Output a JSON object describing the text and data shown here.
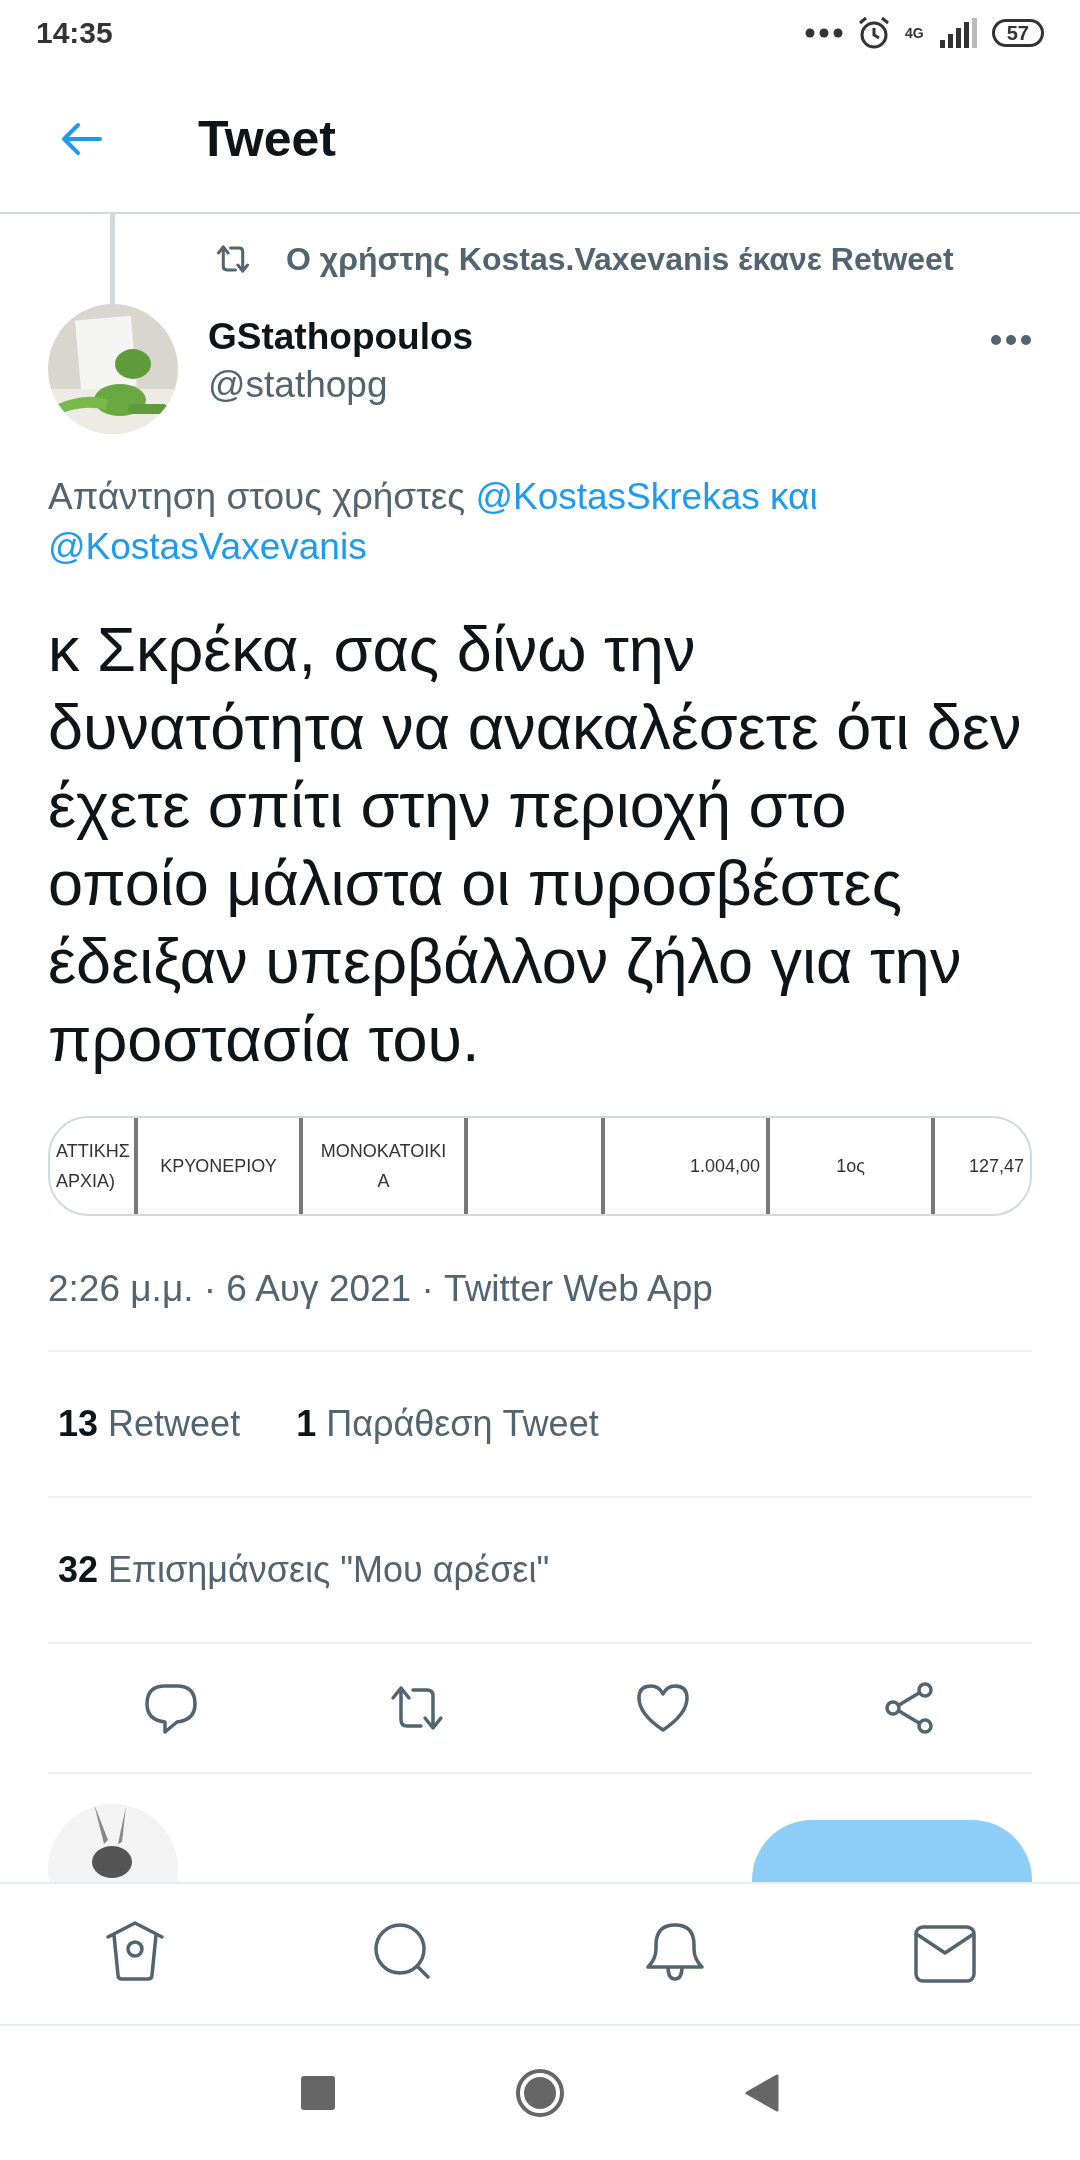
{
  "status_bar": {
    "time": "14:35",
    "network": "4G",
    "battery": "57"
  },
  "header": {
    "title": "Tweet"
  },
  "retweet_note": "Ο χρήστης Kostas.Vaxevanis έκανε Retweet",
  "author": {
    "name": "GStathopoulos",
    "handle": "@stathopg"
  },
  "reply_to": {
    "prefix": "Απάντηση στους χρήστες",
    "mentions": [
      "@KostasSkrekas",
      "@KostasVaxevanis"
    ],
    "joiner": "και"
  },
  "tweet_text": "κ Σκρέκα, σας δίνω την δυνατότητα να ανακαλέσετε ότι δεν έχετε σπίτι στην περιοχή στο οποίο μάλιστα οι πυροσβέστες έδειξαν υπερβάλλον ζήλο για την προστασία του.",
  "attached_table": {
    "cells": [
      {
        "lines": [
          "ΑΤΤΙΚΗΣ",
          "ΑΡΧΙΑ)"
        ]
      },
      {
        "lines": [
          "ΚΡΥΟΝΕΡΙΟΥ"
        ]
      },
      {
        "lines": [
          "ΜΟΝΟΚΑΤΟΙΚΙ",
          "Α"
        ]
      },
      {},
      {
        "lines": [
          "1.004,00"
        ]
      },
      {
        "lines": [
          "1ος"
        ]
      },
      {
        "lines": [
          "127,47"
        ]
      }
    ]
  },
  "meta": "2:26 μ.μ. · 6 Αυγ 2021 · Twitter Web App",
  "stats": [
    [
      {
        "count": "13",
        "label": "Retweet"
      },
      {
        "count": "1",
        "label": "Παράθεση Tweet"
      }
    ],
    [
      {
        "count": "32",
        "label": "Επισημάνσεις \"Μου αρέσει\""
      }
    ]
  ],
  "actions": [
    {
      "kind": "reply"
    },
    {
      "kind": "retweet"
    },
    {
      "kind": "like"
    },
    {
      "kind": "share"
    }
  ],
  "tabs": [
    {
      "kind": "home",
      "selected": false
    },
    {
      "kind": "search",
      "selected": false
    },
    {
      "kind": "notifications",
      "selected": false
    },
    {
      "kind": "messages",
      "selected": false
    }
  ]
}
